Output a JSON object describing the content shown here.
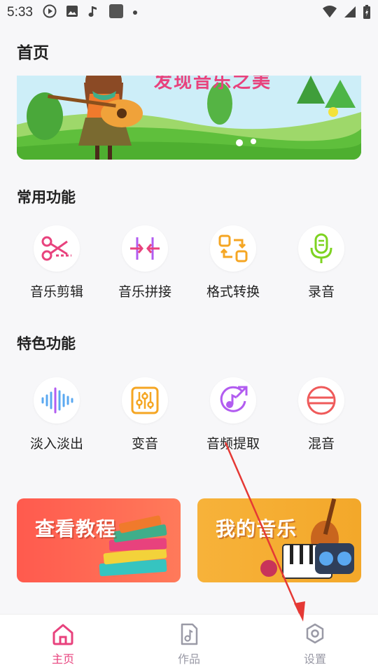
{
  "status_bar": {
    "time": "5:33"
  },
  "header": {
    "title": "首页"
  },
  "banner": {
    "text": "发现音乐之美"
  },
  "common_section": {
    "title": "常用功能",
    "items": [
      {
        "label": "音乐剪辑",
        "icon": "scissors-icon"
      },
      {
        "label": "音乐拼接",
        "icon": "merge-arrows-icon"
      },
      {
        "label": "格式转换",
        "icon": "convert-icon"
      },
      {
        "label": "录音",
        "icon": "microphone-icon"
      }
    ]
  },
  "special_section": {
    "title": "特色功能",
    "items": [
      {
        "label": "淡入淡出",
        "icon": "waveform-icon"
      },
      {
        "label": "变音",
        "icon": "equalizer-icon"
      },
      {
        "label": "音频提取",
        "icon": "music-extract-icon"
      },
      {
        "label": "混音",
        "icon": "mix-icon"
      }
    ]
  },
  "cards": {
    "tutorial": "查看教程",
    "my_music": "我的音乐"
  },
  "bottom_nav": {
    "items": [
      {
        "label": "主页",
        "icon": "home-icon",
        "active": true
      },
      {
        "label": "作品",
        "icon": "music-file-icon",
        "active": false
      },
      {
        "label": "设置",
        "icon": "gear-icon",
        "active": false
      }
    ]
  },
  "colors": {
    "accent_pink": "#e8427d",
    "icon_orange": "#f5a623",
    "icon_green": "#7ed321",
    "icon_purple": "#b25cf0",
    "icon_blue": "#5aa8f0",
    "nav_inactive": "#9a9aa6"
  }
}
